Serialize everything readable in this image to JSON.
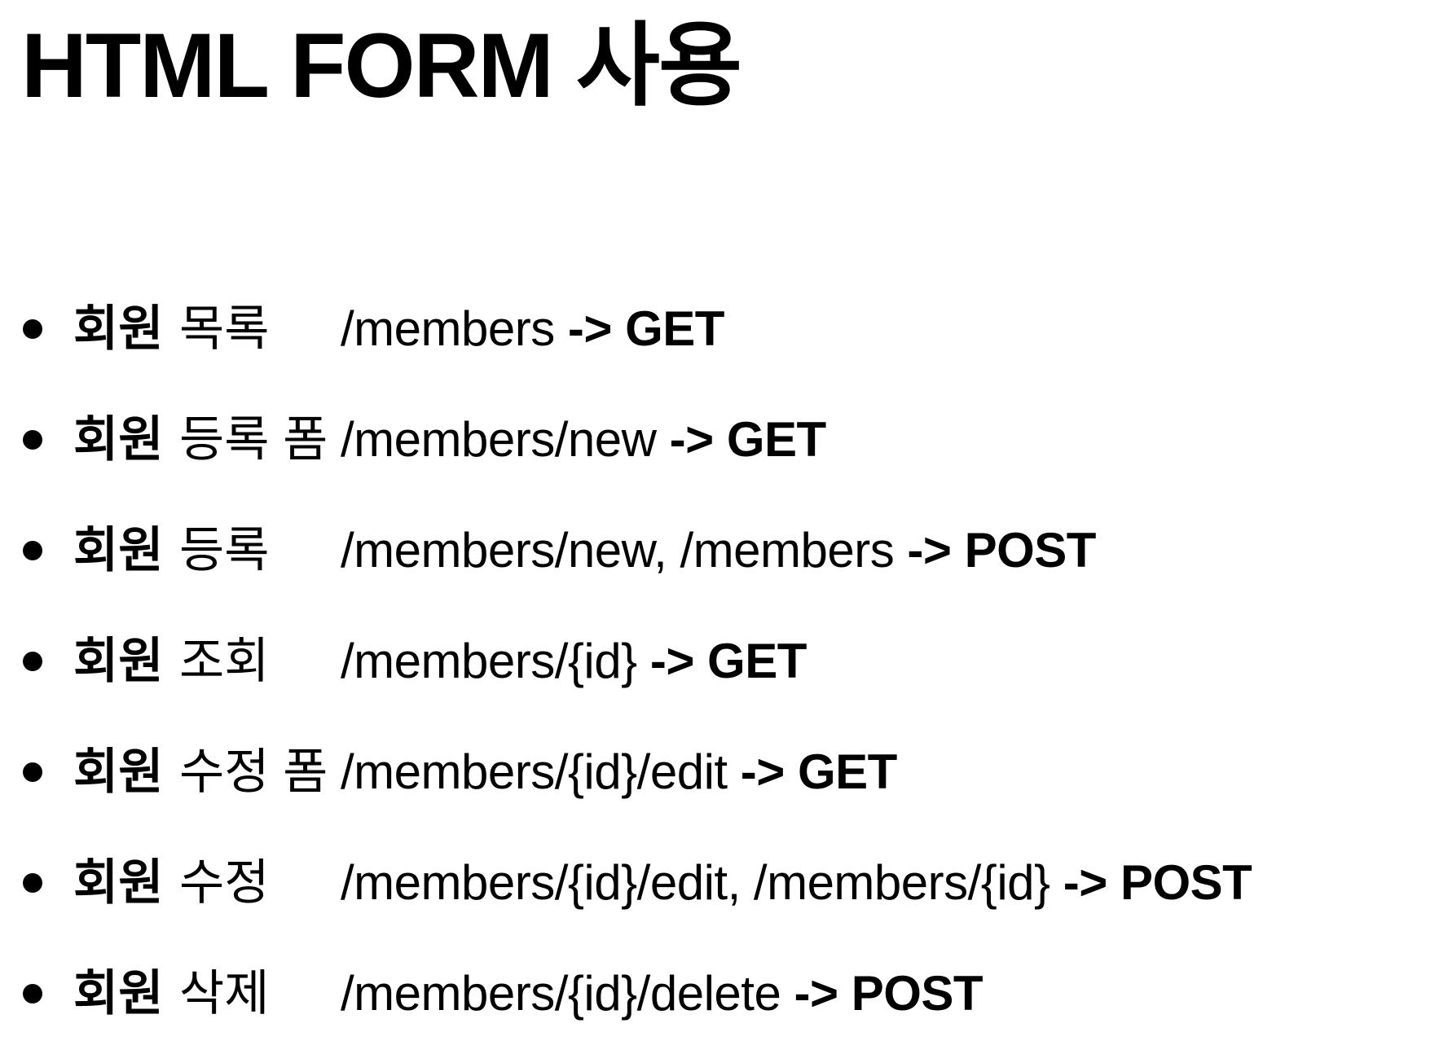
{
  "title": "HTML FORM 사용",
  "items": [
    {
      "subject": "회원",
      "action": "목록",
      "path": "/members",
      "arrow": "->",
      "method": "GET"
    },
    {
      "subject": "회원",
      "action": "등록 폼",
      "path": "/members/new",
      "arrow": "->",
      "method": "GET"
    },
    {
      "subject": "회원",
      "action": "등록",
      "path": "/members/new, /members",
      "arrow": "->",
      "method": "POST"
    },
    {
      "subject": "회원",
      "action": "조회",
      "path": "/members/{id}",
      "arrow": "->",
      "method": "GET"
    },
    {
      "subject": "회원",
      "action": "수정 폼",
      "path": "/members/{id}/edit",
      "arrow": "->",
      "method": "GET"
    },
    {
      "subject": "회원",
      "action": "수정",
      "path": "/members/{id}/edit, /members/{id}",
      "arrow": "->",
      "method": "POST"
    },
    {
      "subject": "회원",
      "action": "삭제",
      "path": "/members/{id}/delete",
      "arrow": "->",
      "method": "POST"
    }
  ]
}
